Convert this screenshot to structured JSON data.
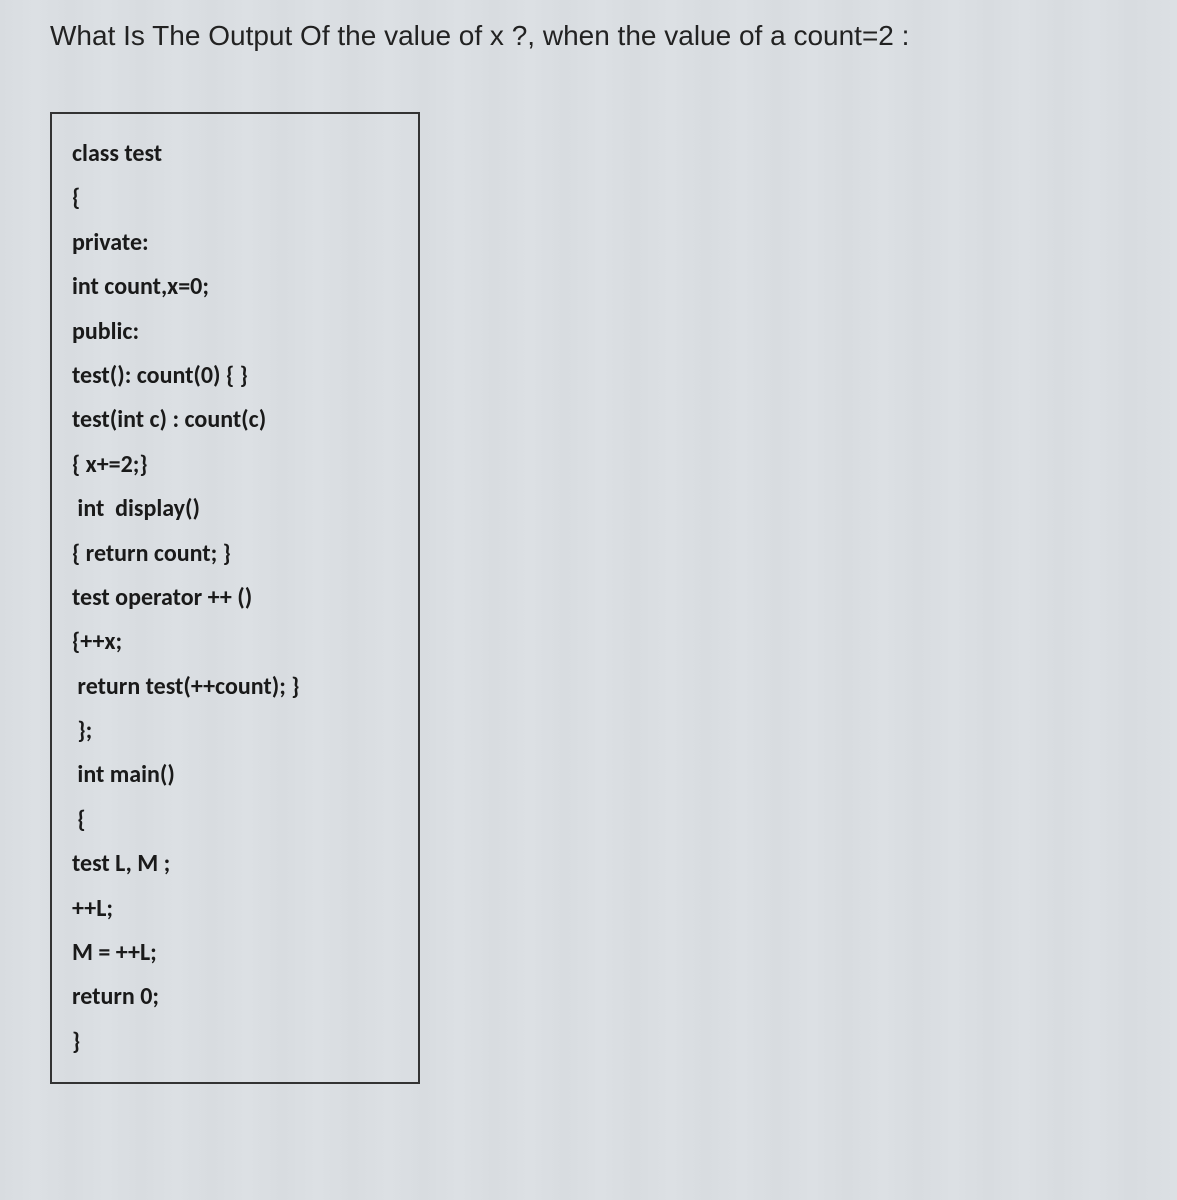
{
  "question": "What Is The Output Of the value of x ?, when the value of a count=2 :",
  "code": {
    "lines": [
      "class test",
      "{",
      "private:",
      "int count,x=0;",
      "public:",
      "test(): count(0) { }",
      "test(int c) : count(c)",
      "{ x+=2;}",
      " int  display()",
      "{ return count; }",
      "test operator ++ ()",
      "{++x;",
      " return test(++count); }",
      " };",
      " int main()",
      " {",
      "test L, M ;",
      "++L;",
      "M = ++L;",
      "return 0;",
      "}"
    ]
  }
}
